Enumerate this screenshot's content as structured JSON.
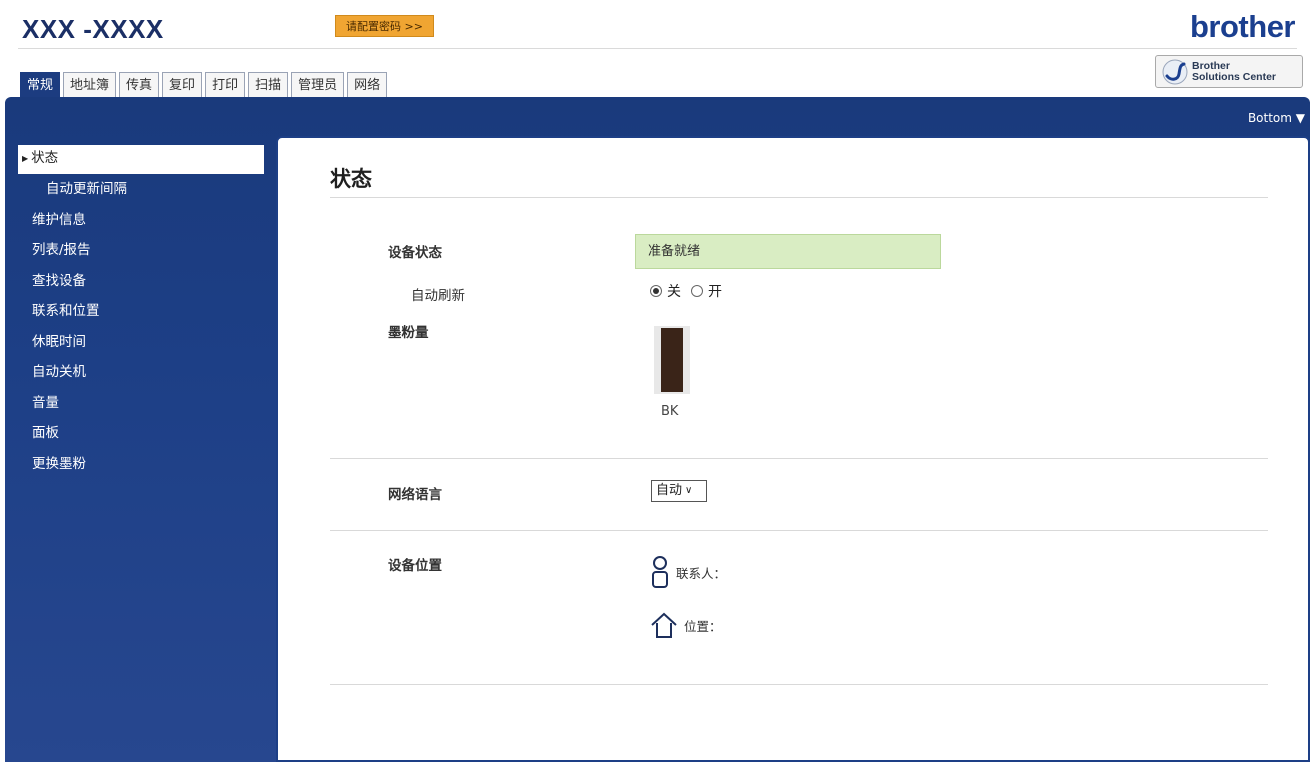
{
  "header": {
    "model": "XXX -XXXX",
    "config_button": "请配置密码 >>",
    "brand": "brother",
    "solutions_center": [
      "Brother",
      "Solutions Center"
    ]
  },
  "tabs": [
    {
      "label": "常规",
      "active": true
    },
    {
      "label": "地址簿"
    },
    {
      "label": "传真"
    },
    {
      "label": "复印"
    },
    {
      "label": "打印"
    },
    {
      "label": "扫描"
    },
    {
      "label": "管理员"
    },
    {
      "label": "网络"
    }
  ],
  "bottom_link": "Bottom ▼",
  "sidebar": {
    "items": [
      {
        "label": "状态",
        "active": true
      },
      {
        "label": "自动更新间隔",
        "sub": true
      },
      {
        "label": "维护信息"
      },
      {
        "label": "列表/报告"
      },
      {
        "label": "查找设备"
      },
      {
        "label": "联系和位置"
      },
      {
        "label": "休眠时间"
      },
      {
        "label": "自动关机"
      },
      {
        "label": "音量"
      },
      {
        "label": "面板"
      },
      {
        "label": "更换墨粉"
      }
    ]
  },
  "main": {
    "title": "状态",
    "device_status_label": "设备状态",
    "device_status_value": "准备就绪",
    "auto_refresh_label": "自动刷新",
    "auto_refresh_options": [
      "关",
      "开"
    ],
    "auto_refresh_selected": "关",
    "toner_label": "墨粉量",
    "toner_name": "BK",
    "toner_level": 1.0,
    "web_language_label": "网络语言",
    "web_language_value": "自动",
    "device_location_label": "设备位置",
    "contact_label": "联系人：",
    "location_label": "位置："
  },
  "colors": {
    "nav_blue": "#1d3f86",
    "accent_orange": "#f0a532",
    "status_green": "#d9edc3",
    "toner_black": "#3a2418"
  }
}
